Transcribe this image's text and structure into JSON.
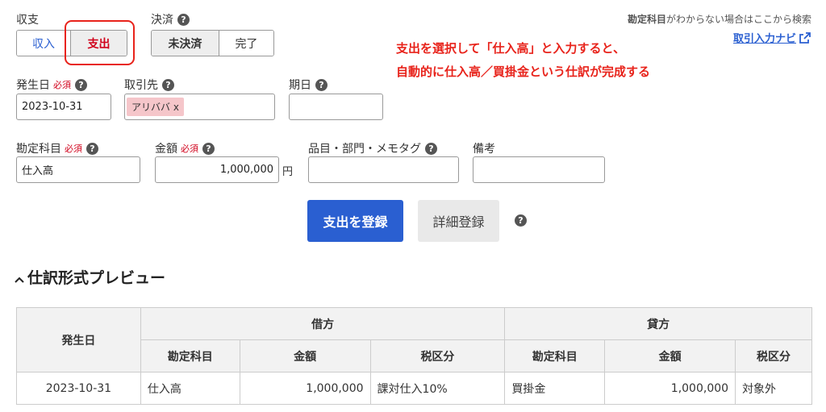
{
  "balance": {
    "label": "収支",
    "options": [
      "収入",
      "支出"
    ],
    "selected": "支出"
  },
  "settlement": {
    "label": "決済",
    "options": [
      "未決済",
      "完了"
    ],
    "selected": "未決済"
  },
  "search": {
    "hint_bold": "勘定科目",
    "hint_rest": "がわからない場合はここから検索",
    "navi_link": "取引入力ナビ"
  },
  "annotation": {
    "line1": "支出を選択して「仕入高」と入力すると、",
    "line2": "自動的に仕入高／買掛金という仕訳が完成する"
  },
  "fields": {
    "date": {
      "label": "発生日",
      "required": "必須",
      "value": "2023-10-31"
    },
    "partner": {
      "label": "取引先",
      "tag": "アリババ x"
    },
    "due": {
      "label": "期日",
      "value": ""
    },
    "account": {
      "label": "勘定科目",
      "required": "必須",
      "value": "仕入高"
    },
    "amount": {
      "label": "金額",
      "required": "必須",
      "value": "1,000,000",
      "unit": "円"
    },
    "items": {
      "label": "品目・部門・メモタグ",
      "value": ""
    },
    "note": {
      "label": "備考",
      "value": ""
    }
  },
  "buttons": {
    "submit": "支出を登録",
    "detail": "詳細登録"
  },
  "preview": {
    "title": "仕訳形式プレビュー",
    "headers": {
      "date": "発生日",
      "debit": "借方",
      "credit": "貸方",
      "account": "勘定科目",
      "amount": "金額",
      "tax": "税区分"
    },
    "row": {
      "date": "2023-10-31",
      "debit_account": "仕入高",
      "debit_amount": "1,000,000",
      "debit_tax": "課対仕入10%",
      "credit_account": "買掛金",
      "credit_amount": "1,000,000",
      "credit_tax": "対象外"
    }
  },
  "colors": {
    "accent_blue": "#2a5fd1",
    "annotation_red": "#e8231b",
    "required_red": "#d0021b",
    "tag_pink": "#f5c6ca"
  }
}
